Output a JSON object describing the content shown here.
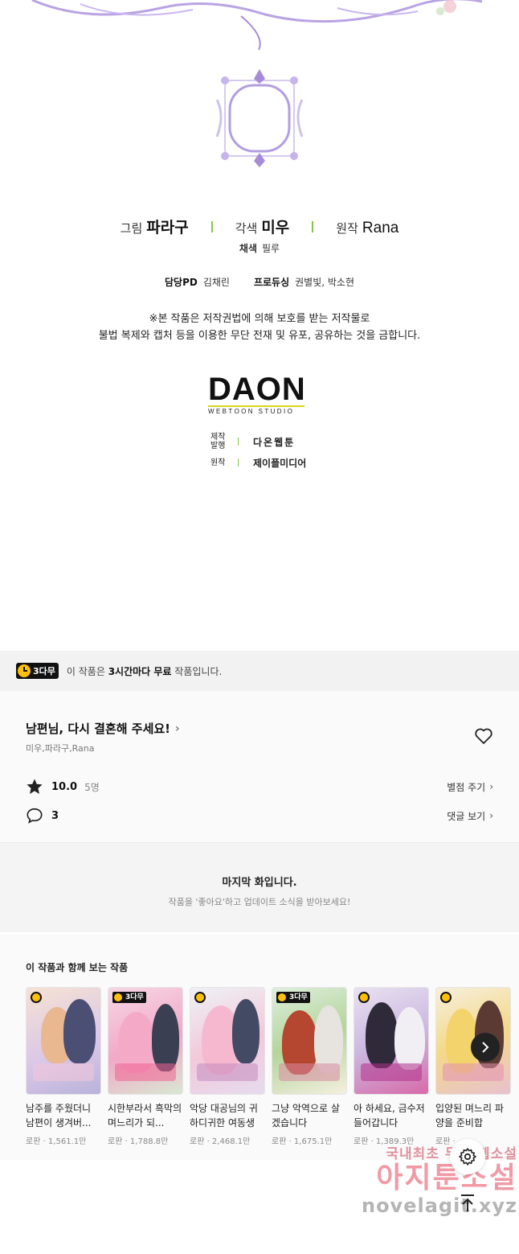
{
  "credits": {
    "staff": [
      {
        "role": "그림",
        "name": "파라구"
      },
      {
        "role": "각색",
        "name": "미우"
      },
      {
        "role": "원작",
        "name": "Rana"
      }
    ],
    "colorist_label": "채색",
    "colorist_name": "필루",
    "pd_label": "담당PD",
    "pd_name": "김채린",
    "producing_label": "프로듀싱",
    "producing_name": "권별빛, 박소현",
    "notice_line1": "※본 작품은 저작권법에 의해 보호를 받는 저작물로",
    "notice_line2": "불법 복제와 캡처 등을 이용한 무단 전재 및 유포, 공유하는 것을 금합니다.",
    "studio_logo": "DAON",
    "studio_sub": "WEBTOON STUDIO",
    "publish_label_1": "제작",
    "publish_label_2": "발행",
    "publish_value": "다온웹툰",
    "origin_label": "원작",
    "origin_value": "제이플미디어"
  },
  "free_banner": {
    "badge": "3다무",
    "text_prefix": "이 작품은 ",
    "text_bold": "3시간마다 무료",
    "text_suffix": " 작품입니다."
  },
  "series": {
    "title": "남편님, 다시 결혼해 주세요!",
    "authors": "미우,파라구,Rana",
    "score": "10.0",
    "rater_count": "5명",
    "rate_link": "별점 주기",
    "comment_count": "3",
    "comment_link": "댓글 보기"
  },
  "last_episode": {
    "title": "마지막 화입니다.",
    "subtitle": "작품을 '좋아요'하고 업데이트 소식을 받아보세요!"
  },
  "recommendations": {
    "heading": "이 작품과 함께 보는 작품",
    "items": [
      {
        "title": "남주를 주웠더니 남편이 생겨버...",
        "meta": "로판 · 1,561.1만",
        "badge": ""
      },
      {
        "title": "시한부라서 흑막의 며느리가 되...",
        "meta": "로판 · 1,788.8만",
        "badge": "3다무"
      },
      {
        "title": "악당 대공님의 귀하디귀한 여동생",
        "meta": "로판 · 2,468.1만",
        "badge": ""
      },
      {
        "title": "그냥 악역으로 살겠습니다",
        "meta": "로판 · 1,675.1만",
        "badge": "3다무"
      },
      {
        "title": "아 하세요, 금수저 들어갑니다",
        "meta": "로판 · 1,389.3만",
        "badge": ""
      },
      {
        "title": "입양된 며느리 파양을 준비합",
        "meta": "로판 · ",
        "badge": ""
      }
    ]
  },
  "watermark": {
    "line1": "국내최초 무료 웹소설",
    "line2": "아지툰소설",
    "line3": "novelagit.xyz"
  },
  "colors": {
    "accent_green": "#8bc34a",
    "badge_yellow": "#ffc107",
    "logo_bar": "#d4d61c"
  }
}
